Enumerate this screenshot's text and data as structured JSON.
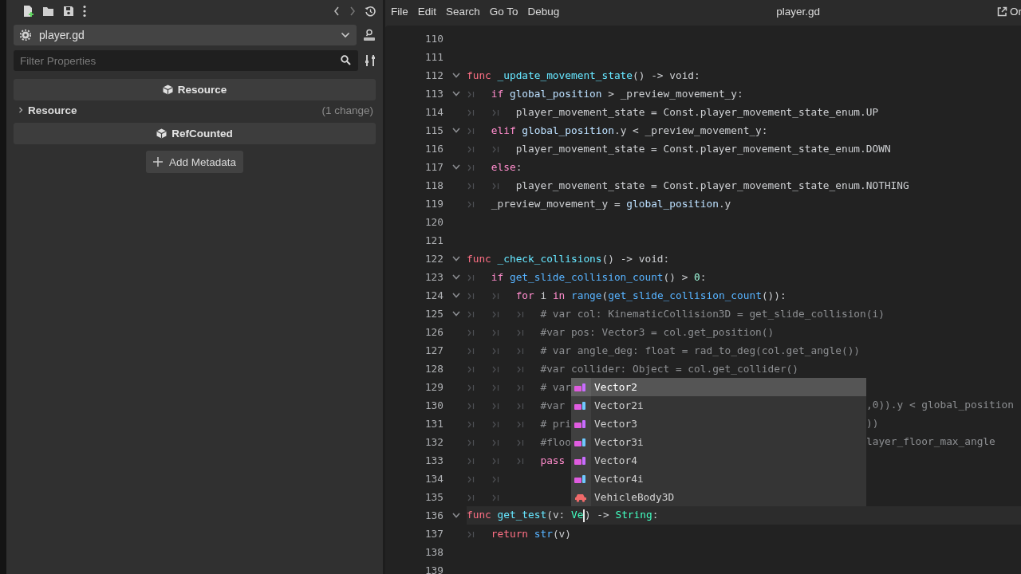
{
  "inspector": {
    "dropdown": {
      "value": "player.gd"
    },
    "filter": {
      "placeholder": "Filter Properties"
    },
    "sections": [
      {
        "kind": "header",
        "label": "Resource"
      },
      {
        "kind": "category",
        "label": "Resource",
        "expanded": false,
        "note": "(1 change)"
      },
      {
        "kind": "header",
        "label": "RefCounted"
      }
    ],
    "add_button": {
      "label": "Add Metadata"
    }
  },
  "editor": {
    "menu": [
      "File",
      "Edit",
      "Search",
      "Go To",
      "Debug"
    ],
    "title": "player.gd",
    "open_link": "Or",
    "lines": [
      {
        "number": "110",
        "fold": false,
        "current": false
      },
      {
        "number": "111",
        "fold": false,
        "current": false
      },
      {
        "number": "112",
        "fold": true,
        "current": false,
        "tokens": [
          {
            "kind": "kw",
            "text": "func "
          },
          {
            "kind": "fn",
            "text": "_update_movement_state"
          },
          {
            "kind": "text",
            "text": "() -> void:"
          }
        ]
      },
      {
        "number": "113",
        "fold": true,
        "current": false,
        "guides": [
          {
            "kind": "tab"
          }
        ],
        "tokens": [
          {
            "kind": "ctrl",
            "text": "if "
          },
          {
            "kind": "member",
            "text": "global_position"
          },
          {
            "kind": "text",
            "text": " > _preview_movement_y:"
          }
        ]
      },
      {
        "number": "114",
        "fold": false,
        "current": false,
        "guides": [
          {
            "kind": "tab"
          },
          {
            "kind": "tab"
          }
        ],
        "tokens": [
          {
            "kind": "text",
            "text": "player_movement_state = Const.player_movement_state_enum.UP"
          }
        ]
      },
      {
        "number": "115",
        "fold": true,
        "current": false,
        "guides": [
          {
            "kind": "tab"
          }
        ],
        "tokens": [
          {
            "kind": "ctrl",
            "text": "elif "
          },
          {
            "kind": "member",
            "text": "global_position"
          },
          {
            "kind": "text",
            "text": ".y < _preview_movement_y:"
          }
        ]
      },
      {
        "number": "116",
        "fold": false,
        "current": false,
        "guides": [
          {
            "kind": "tab"
          },
          {
            "kind": "tab"
          }
        ],
        "tokens": [
          {
            "kind": "text",
            "text": "player_movement_state = Const.player_movement_state_enum.DOWN"
          }
        ]
      },
      {
        "number": "117",
        "fold": true,
        "current": false,
        "guides": [
          {
            "kind": "tab"
          }
        ],
        "tokens": [
          {
            "kind": "ctrl",
            "text": "else"
          },
          {
            "kind": "text",
            "text": ":"
          }
        ]
      },
      {
        "number": "118",
        "fold": false,
        "current": false,
        "guides": [
          {
            "kind": "tab"
          },
          {
            "kind": "tab"
          }
        ],
        "tokens": [
          {
            "kind": "text",
            "text": "player_movement_state = Const.player_movement_state_enum.NOTHING"
          }
        ]
      },
      {
        "number": "119",
        "fold": false,
        "current": false,
        "guides": [
          {
            "kind": "tab"
          }
        ],
        "tokens": [
          {
            "kind": "text",
            "text": "_preview_movement_y = "
          },
          {
            "kind": "member",
            "text": "global_position"
          },
          {
            "kind": "text",
            "text": ".y"
          }
        ]
      },
      {
        "number": "120",
        "fold": false,
        "current": false
      },
      {
        "number": "121",
        "fold": false,
        "current": false
      },
      {
        "number": "122",
        "fold": true,
        "current": false,
        "tokens": [
          {
            "kind": "kw",
            "text": "func "
          },
          {
            "kind": "fn",
            "text": "_check_collisions"
          },
          {
            "kind": "text",
            "text": "() -> void:"
          }
        ]
      },
      {
        "number": "123",
        "fold": true,
        "current": false,
        "guides": [
          {
            "kind": "tab"
          }
        ],
        "tokens": [
          {
            "kind": "ctrl",
            "text": "if "
          },
          {
            "kind": "call",
            "text": "get_slide_collision_count"
          },
          {
            "kind": "text",
            "text": "() > "
          },
          {
            "kind": "num",
            "text": "0"
          },
          {
            "kind": "text",
            "text": ":"
          }
        ]
      },
      {
        "number": "124",
        "fold": true,
        "current": false,
        "guides": [
          {
            "kind": "tab"
          },
          {
            "kind": "tab"
          }
        ],
        "tokens": [
          {
            "kind": "ctrl",
            "text": "for"
          },
          {
            "kind": "text",
            "text": " i "
          },
          {
            "kind": "ctrl",
            "text": "in"
          },
          {
            "kind": "call",
            "text": " range"
          },
          {
            "kind": "text",
            "text": "("
          },
          {
            "kind": "call",
            "text": "get_slide_collision_count"
          },
          {
            "kind": "text",
            "text": "()):"
          }
        ]
      },
      {
        "number": "125",
        "fold": true,
        "current": false,
        "guides": [
          {
            "kind": "tab"
          },
          {
            "kind": "tab"
          },
          {
            "kind": "tab"
          }
        ],
        "tokens": [
          {
            "kind": "comment",
            "text": "# var col: KinematicCollision3D = get_slide_collision(i)"
          }
        ]
      },
      {
        "number": "126",
        "fold": false,
        "current": false,
        "guides": [
          {
            "kind": "tab"
          },
          {
            "kind": "tab"
          },
          {
            "kind": "tab"
          }
        ],
        "tokens": [
          {
            "kind": "comment",
            "text": "#var pos: Vector3 = col.get_position()"
          }
        ]
      },
      {
        "number": "127",
        "fold": false,
        "current": false,
        "guides": [
          {
            "kind": "tab"
          },
          {
            "kind": "tab"
          },
          {
            "kind": "tab"
          }
        ],
        "tokens": [
          {
            "kind": "comment",
            "text": "# var angle_deg: float = rad_to_deg(col.get_angle())"
          }
        ]
      },
      {
        "number": "128",
        "fold": false,
        "current": false,
        "guides": [
          {
            "kind": "tab"
          },
          {
            "kind": "tab"
          },
          {
            "kind": "tab"
          }
        ],
        "tokens": [
          {
            "kind": "comment",
            "text": "#var collider: Object = col.get_collider()"
          }
        ]
      },
      {
        "number": "129",
        "fold": false,
        "current": false,
        "guides": [
          {
            "kind": "tab"
          },
          {
            "kind": "tab"
          },
          {
            "kind": "tab"
          }
        ],
        "tokens": [
          {
            "kind": "comment",
            "text": "# var"
          }
        ]
      },
      {
        "number": "130",
        "fold": false,
        "current": false,
        "guides": [
          {
            "kind": "tab"
          },
          {
            "kind": "tab"
          },
          {
            "kind": "tab"
          }
        ],
        "tokens": [
          {
            "kind": "comment",
            "text": "#var"
          }
        ],
        "tail": ",0)).y < global_position"
      },
      {
        "number": "131",
        "fold": false,
        "current": false,
        "guides": [
          {
            "kind": "tab"
          },
          {
            "kind": "tab"
          },
          {
            "kind": "tab"
          }
        ],
        "tokens": [
          {
            "kind": "comment",
            "text": "# pri"
          }
        ],
        "tail": "))"
      },
      {
        "number": "132",
        "fold": false,
        "current": false,
        "guides": [
          {
            "kind": "tab"
          },
          {
            "kind": "tab"
          },
          {
            "kind": "tab"
          }
        ],
        "tokens": [
          {
            "kind": "comment",
            "text": "#floo"
          }
        ],
        "tail": "layer_floor_max_angle"
      },
      {
        "number": "133",
        "fold": false,
        "current": false,
        "guides": [
          {
            "kind": "tab"
          },
          {
            "kind": "tab"
          },
          {
            "kind": "tab"
          }
        ],
        "tokens": [
          {
            "kind": "ctrl",
            "text": "pass"
          }
        ]
      },
      {
        "number": "134",
        "fold": false,
        "current": false,
        "guides": [
          {
            "kind": "tab"
          },
          {
            "kind": "tab"
          }
        ]
      },
      {
        "number": "135",
        "fold": false,
        "current": false,
        "guides": [
          {
            "kind": "tab"
          },
          {
            "kind": "tab"
          }
        ]
      },
      {
        "number": "136",
        "fold": true,
        "current": true,
        "tokens": [
          {
            "kind": "kw",
            "text": "func "
          },
          {
            "kind": "fn",
            "text": "get_test"
          },
          {
            "kind": "text",
            "text": "(v: "
          },
          {
            "kind": "type",
            "text": "Ve",
            "caret": true
          },
          {
            "kind": "text",
            "text": ") -> "
          },
          {
            "kind": "type",
            "text": "String"
          },
          {
            "kind": "text",
            "text": ":"
          }
        ]
      },
      {
        "number": "137",
        "fold": false,
        "current": false,
        "guides": [
          {
            "kind": "tab"
          }
        ],
        "tokens": [
          {
            "kind": "kw",
            "text": "return "
          },
          {
            "kind": "call",
            "text": "str"
          },
          {
            "kind": "text",
            "text": "(v)"
          }
        ]
      },
      {
        "number": "138",
        "fold": false,
        "current": false
      },
      {
        "number": "139",
        "fold": false,
        "current": false
      }
    ],
    "completion": [
      {
        "label": "Vector2",
        "kind": "vector",
        "selected": true
      },
      {
        "label": "Vector2i",
        "kind": "vector",
        "selected": false
      },
      {
        "label": "Vector3",
        "kind": "vector",
        "selected": false
      },
      {
        "label": "Vector3i",
        "kind": "vector",
        "selected": false
      },
      {
        "label": "Vector4",
        "kind": "vector",
        "selected": false
      },
      {
        "label": "Vector4i",
        "kind": "vector",
        "selected": false
      },
      {
        "label": "VehicleBody3D",
        "kind": "vehicle",
        "selected": false
      }
    ]
  }
}
